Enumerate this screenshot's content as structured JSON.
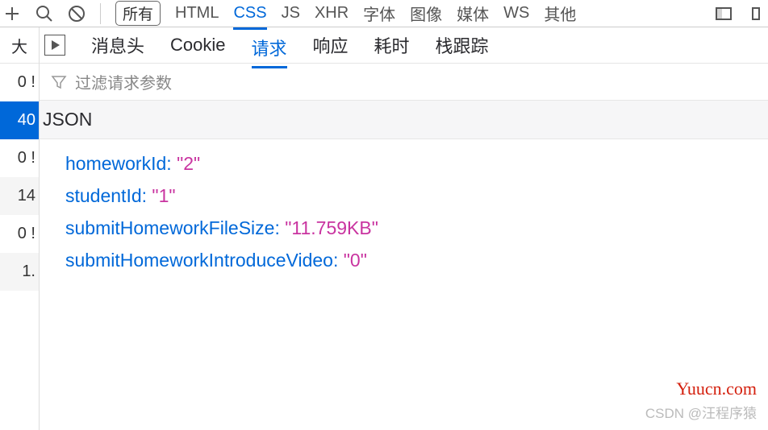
{
  "toolbar": {
    "filters": {
      "all": "所有",
      "html": "HTML",
      "css": "CSS",
      "js": "JS",
      "xhr": "XHR",
      "font": "字体",
      "image": "图像",
      "media": "媒体",
      "ws": "WS",
      "other": "其他"
    }
  },
  "sidebar": {
    "header": "大",
    "rows": [
      "0 !",
      "40",
      "0 !",
      "14",
      "0 !",
      "1."
    ]
  },
  "detailTabs": {
    "headers": "消息头",
    "cookie": "Cookie",
    "request": "请求",
    "response": "响应",
    "timing": "耗时",
    "stack": "栈跟踪"
  },
  "filterPlaceholder": "过滤请求参数",
  "sectionTitle": "JSON",
  "json": [
    {
      "key": "homeworkId",
      "val": "\"2\""
    },
    {
      "key": "studentId",
      "val": "\"1\""
    },
    {
      "key": "submitHomeworkFileSize",
      "val": "\"11.759KB\""
    },
    {
      "key": "submitHomeworkIntroduceVideo",
      "val": "\"0\""
    }
  ],
  "watermark1": "Yuucn.com",
  "watermark2": "CSDN @汪程序猿"
}
